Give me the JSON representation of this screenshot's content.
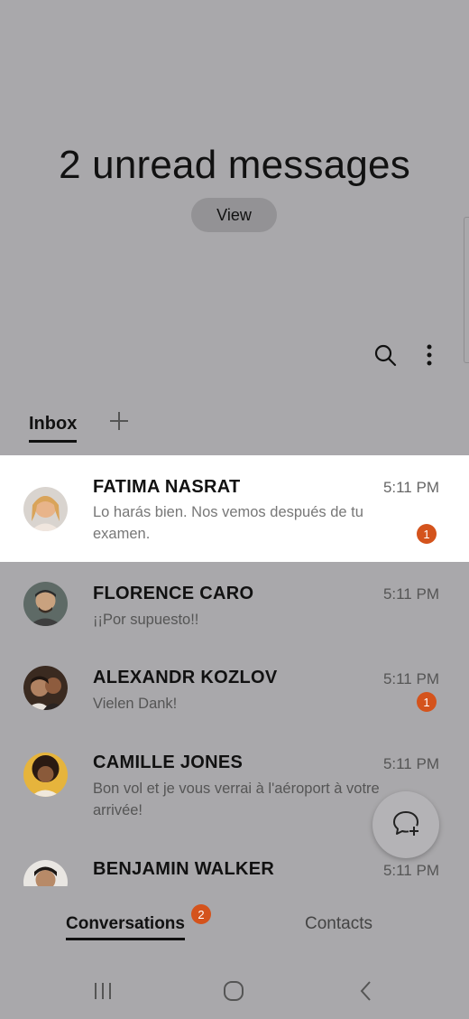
{
  "header": {
    "title": "2 unread messages",
    "view_label": "View"
  },
  "toolbar": {
    "search_icon": "search-icon",
    "more_icon": "more-vertical-icon"
  },
  "top_tabs": {
    "inbox_label": "Inbox",
    "add_icon": "plus-icon"
  },
  "conversations": [
    {
      "name": "FATIMA NASRAT",
      "time": "5:11 PM",
      "preview": "Lo harás bien. Nos vemos después de tu examen.",
      "unread": "1",
      "highlighted": true,
      "avatar_color": "#e8c9a8"
    },
    {
      "name": "FLORENCE CARO",
      "time": "5:11 PM",
      "preview": "¡¡Por supuesto!!",
      "unread": "",
      "highlighted": false,
      "avatar_color": "#5a5a58"
    },
    {
      "name": "ALEXANDR KOZLOV",
      "time": "5:11 PM",
      "preview": "Vielen Dank!",
      "unread": "1",
      "highlighted": false,
      "avatar_color": "#4a3b30"
    },
    {
      "name": "CAMILLE JONES",
      "time": "5:11 PM",
      "preview": "Bon vol et je vous verrai à l'aéroport à votre arrivée!",
      "unread": "",
      "highlighted": false,
      "avatar_color": "#d9a63a"
    },
    {
      "name": "BENJAMIN WALKER",
      "time": "5:11 PM",
      "preview": "",
      "unread": "",
      "highlighted": false,
      "avatar_color": "#3d3530"
    }
  ],
  "fab": {
    "icon": "new-message-icon"
  },
  "bottom_tabs": {
    "conversations_label": "Conversations",
    "conversations_badge": "2",
    "contacts_label": "Contacts"
  },
  "navbar": {
    "recents_icon": "recents-icon",
    "home_icon": "home-icon",
    "back_icon": "back-icon"
  },
  "colors": {
    "background": "#a9a8ab",
    "badge": "#d4531c",
    "highlight_row": "#ffffff"
  }
}
